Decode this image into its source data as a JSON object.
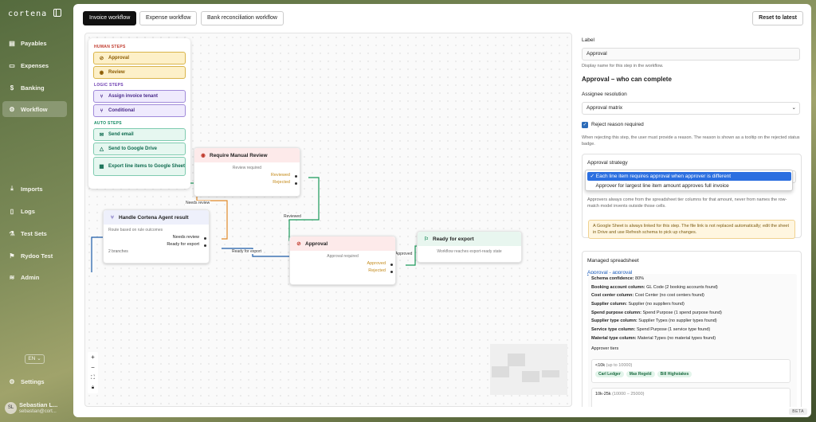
{
  "app": {
    "brand": "cortena"
  },
  "sidebar": {
    "items": [
      {
        "label": "Payables",
        "icon": "file-icon",
        "glyph": "▤"
      },
      {
        "label": "Expenses",
        "icon": "receipt-icon",
        "glyph": "▭"
      },
      {
        "label": "Banking",
        "icon": "dollar-icon",
        "glyph": "$"
      },
      {
        "label": "Workflow",
        "icon": "workflow-icon",
        "glyph": "⚙",
        "active": true
      }
    ],
    "items2": [
      {
        "label": "Imports",
        "icon": "download-icon",
        "glyph": "⤓"
      },
      {
        "label": "Logs",
        "icon": "book-icon",
        "glyph": "▯"
      },
      {
        "label": "Test Sets",
        "icon": "flask-icon",
        "glyph": "⚗"
      },
      {
        "label": "Rydoo Test",
        "icon": "test-icon",
        "glyph": "⚑"
      },
      {
        "label": "Admin",
        "icon": "layers-icon",
        "glyph": "≋"
      }
    ],
    "language": "EN",
    "settings": "Settings",
    "user": {
      "initials": "SL",
      "name": "Sebastian L...",
      "email": "sebastian@cort..."
    }
  },
  "tabs": [
    {
      "label": "Invoice workflow",
      "active": true
    },
    {
      "label": "Expense workflow"
    },
    {
      "label": "Bank reconciliation workflow"
    }
  ],
  "reset_label": "Reset to latest",
  "palette": {
    "human_title": "HUMAN STEPS",
    "human": [
      "Approval",
      "Review"
    ],
    "logic_title": "LOGIC STEPS",
    "logic": [
      "Assign invoice tenant",
      "Conditional"
    ],
    "auto_title": "AUTO STEPS",
    "auto": [
      "Send email",
      "Send to Google Drive",
      "Export line items to Google Sheet"
    ]
  },
  "nodes": {
    "review": {
      "title": "Require Manual Review",
      "sub": "Review required",
      "ports": [
        "Reviewed",
        "Rejected"
      ]
    },
    "agent": {
      "title": "Handle Cortena Agent result",
      "sub": "Route based on rule outcomes",
      "ports": [
        "Needs review",
        "Ready for export"
      ],
      "foot": "2 branches"
    },
    "approval": {
      "title": "Approval",
      "sub": "Approval required",
      "ports": [
        "Approved",
        "Rejected"
      ]
    },
    "export": {
      "title": "Ready for export",
      "sub": "Workflow reaches export-ready state"
    }
  },
  "edge_labels": {
    "needs_review": "Needs review",
    "reviewed": "Reviewed",
    "ready_for_export": "Ready for export",
    "approved": "Approved"
  },
  "panel": {
    "label_title": "Label",
    "label_value": "Approval",
    "label_hint": "Display name for this step in the workflow.",
    "section_title": "Approval – who can complete",
    "assignee_title": "Assignee resolution",
    "assignee_value": "Approval matrix",
    "reject_label": "Reject reason required",
    "reject_hint": "When rejecting this step, the user must provide a reason. The reason is shown as a tooltip on the rejected status badge.",
    "strategy_title": "Approval strategy",
    "strategy_options": [
      "Each line item requires approval when approver is different",
      "Approver for largest line item amount approves full invoice"
    ],
    "strategy_hint": "Approvers always come from the spreadsheet tier columns for that amount, never from names the row-match model invents outside those cells.",
    "warning": "A Google Sheet is always linked for this step. The file link is not replaced automatically; edit the sheet in Drive and use Refresh schema to pick up changes.",
    "managed_title": "Managed spreadsheet",
    "sheet_link": "Approval - approval",
    "schema": [
      {
        "k": "Schema confidence:",
        "v": "80%"
      },
      {
        "k": "Booking account column:",
        "v": "GL Code (2 booking accounts found)"
      },
      {
        "k": "Cost center column:",
        "v": "Cost Center (no cost centers found)"
      },
      {
        "k": "Supplier column:",
        "v": "Supplier (no suppliers found)"
      },
      {
        "k": "Spend purpose column:",
        "v": "Spend Purpose (1 spend purpose found)"
      },
      {
        "k": "Supplier type column:",
        "v": "Supplier Types (no supplier types found)"
      },
      {
        "k": "Service type column:",
        "v": "Spend Purpose (1 service type found)"
      },
      {
        "k": "Material type column:",
        "v": "Material Types (no material types found)"
      }
    ],
    "tiers_title": "Approver tiers",
    "tier1": {
      "name": "<10k",
      "range": "(up to 10000)",
      "people": [
        "Carl Ledger",
        "Max Regeld",
        "Bill Highstakes"
      ]
    },
    "tier2": {
      "name": "10k-25k",
      "range": "(10000 – 25000)"
    }
  },
  "beta": "BETA"
}
